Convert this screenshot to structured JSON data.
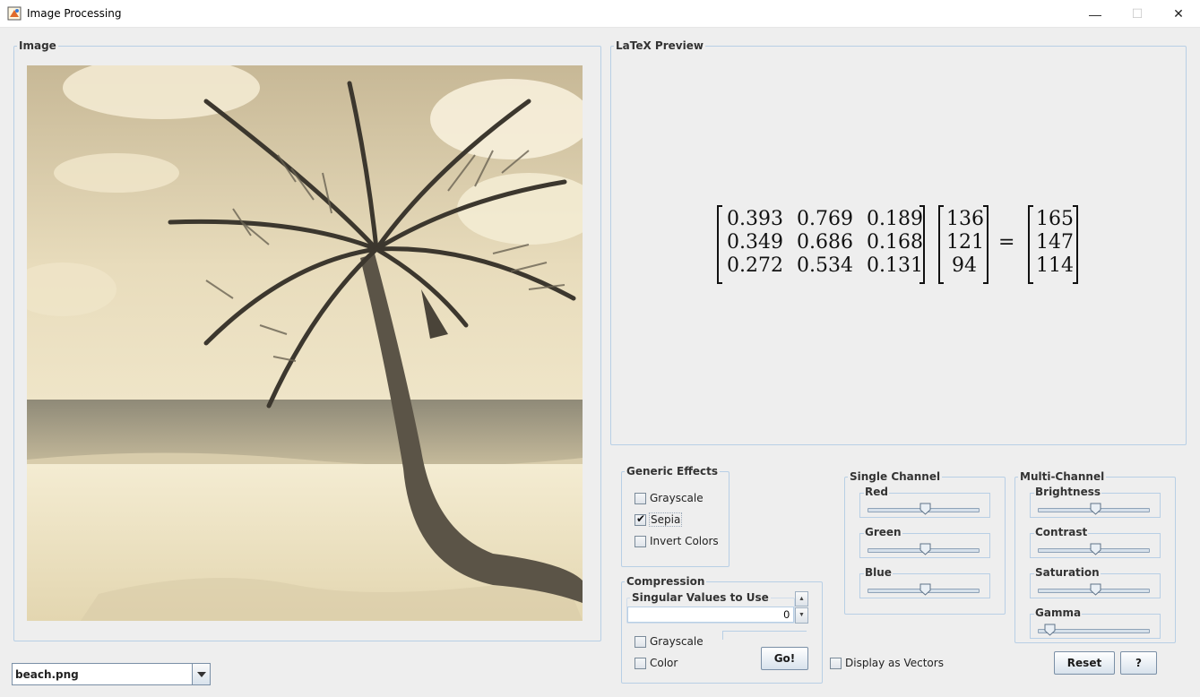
{
  "window": {
    "title": "Image Processing",
    "controls": {
      "minimize": "—",
      "maximize": "☐",
      "close": "✕"
    }
  },
  "image_panel": {
    "legend": "Image",
    "image_description_icon": "beach-palm-sepia"
  },
  "latex_panel": {
    "legend": "LaTeX Preview",
    "matrix": [
      [
        "0.393",
        "0.769",
        "0.189"
      ],
      [
        "0.349",
        "0.686",
        "0.168"
      ],
      [
        "0.272",
        "0.534",
        "0.131"
      ]
    ],
    "input_vector": [
      "136",
      "121",
      "94"
    ],
    "equals": "=",
    "output_vector": [
      "165",
      "147",
      "114"
    ]
  },
  "generic_effects": {
    "legend": "Generic Effects",
    "options": [
      {
        "label": "Grayscale",
        "checked": false
      },
      {
        "label": "Sepia",
        "checked": true
      },
      {
        "label": "Invert Colors",
        "checked": false
      }
    ]
  },
  "compression": {
    "legend": "Compression",
    "spinner_label": "Singular Values to Use",
    "spinner_value": "0",
    "options": [
      {
        "label": "Grayscale",
        "checked": false
      },
      {
        "label": "Color",
        "checked": false
      }
    ],
    "go_label": "Go!"
  },
  "display_vectors": {
    "label": "Display as Vectors",
    "checked": false
  },
  "single_channel": {
    "legend": "Single Channel",
    "sliders": [
      {
        "label": "Red",
        "value": 0.5
      },
      {
        "label": "Green",
        "value": 0.5
      },
      {
        "label": "Blue",
        "value": 0.5
      }
    ]
  },
  "multi_channel": {
    "legend": "Multi-Channel",
    "sliders": [
      {
        "label": "Brightness",
        "value": 0.5
      },
      {
        "label": "Contrast",
        "value": 0.5
      },
      {
        "label": "Saturation",
        "value": 0.5
      },
      {
        "label": "Gamma",
        "value": 0.05
      }
    ]
  },
  "buttons": {
    "reset": "Reset",
    "help": "?"
  },
  "file_select": {
    "value": "beach.png"
  }
}
